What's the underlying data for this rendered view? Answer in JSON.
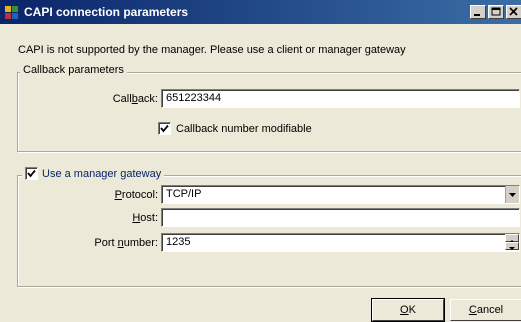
{
  "window": {
    "title": "CAPI connection parameters",
    "controls": {
      "minimize_icon": "minimize-icon",
      "maximize_icon": "maximize-icon",
      "close_icon": "close-icon"
    }
  },
  "message": "CAPI is not supported by the manager. Please use a client or manager gateway",
  "callback_group": {
    "legend": "Callback parameters",
    "callback_label_pre": "Call",
    "callback_label_u": "b",
    "callback_label_post": "ack:",
    "callback_value": "651223344",
    "modifiable_label": "Callback number modifiable",
    "modifiable_checked": true
  },
  "gateway_group": {
    "legend": "Use a manager gateway",
    "legend_checked": true,
    "protocol_label_u": "P",
    "protocol_label_post": "rotocol:",
    "protocol_value": "TCP/IP",
    "host_label_u": "H",
    "host_label_post": "ost:",
    "host_value": "",
    "port_label_pre": "Port ",
    "port_label_u": "n",
    "port_label_post": "umber:",
    "port_value": "1235"
  },
  "buttons": {
    "ok_u": "O",
    "ok_post": "K",
    "cancel_u": "C",
    "cancel_post": "ancel"
  }
}
